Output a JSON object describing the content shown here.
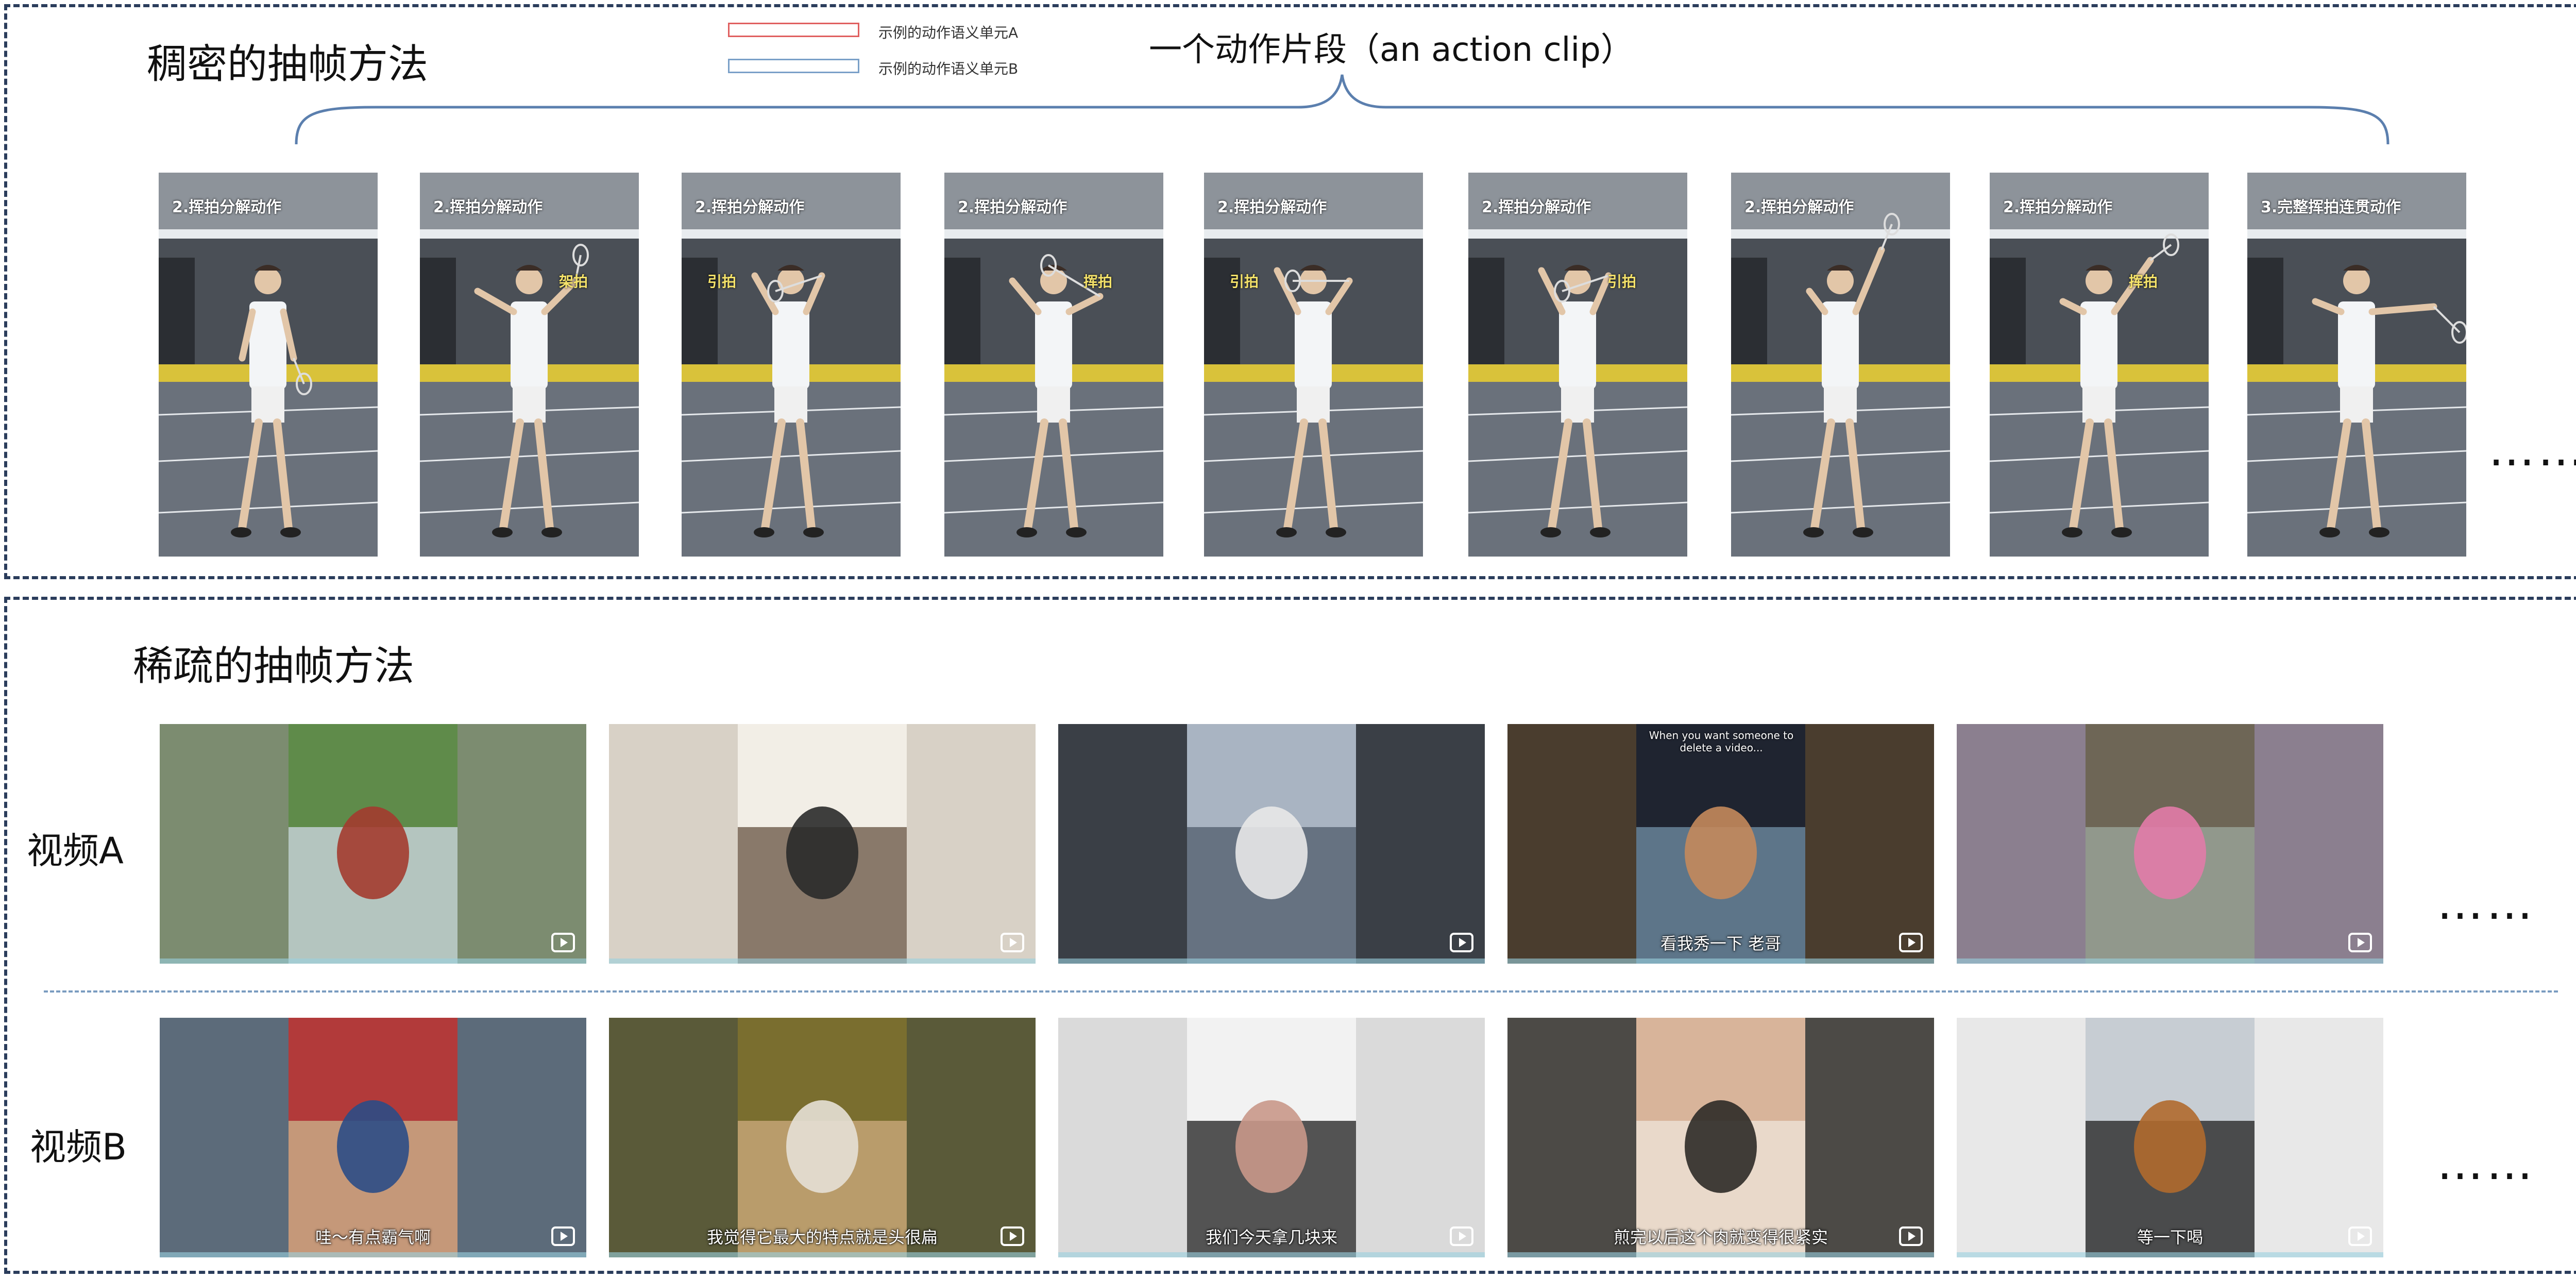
{
  "dense_section": {
    "title": "稠密的抽帧方法",
    "legend": [
      {
        "label": "示例的动作语义单元A",
        "color": "#e06060"
      },
      {
        "label": "示例的动作语义单元B",
        "color": "#7aa0c8"
      }
    ],
    "clip_label": "一个动作片段（an action clip）",
    "frame_tags": [
      "2.挥拍分解动作",
      "2.挥拍分解动作",
      "2.挥拍分解动作",
      "2.挥拍分解动作",
      "2.挥拍分解动作",
      "2.挥拍分解动作",
      "2.挥拍分解动作",
      "2.挥拍分解动作",
      "3.完整挥拍连贯动作"
    ],
    "frame_notes": [
      "",
      "架拍",
      "引拍",
      "挥拍",
      "引拍",
      "引拍",
      "",
      "挥拍",
      ""
    ],
    "ellipsis": "……"
  },
  "sparse_section": {
    "title": "稀疏的抽帧方法",
    "video_a": {
      "label": "视频A",
      "captions": [
        "",
        "",
        "",
        "看我秀一下 老哥",
        ""
      ],
      "top_text": [
        "",
        "",
        "",
        "When you want someone to delete a video...",
        ""
      ],
      "ellipsis": "……"
    },
    "video_b": {
      "label": "视频B",
      "captions": [
        "哇～有点霸气啊",
        "我觉得它最大的特点就是头很扁",
        "我们今天拿几块来",
        "煎完以后这个肉就变得很紧实",
        "等一下喝"
      ],
      "ellipsis": "……"
    }
  },
  "colors": {
    "border": "#2b3d5c",
    "brace": "#5b7fae",
    "divider": "#7a9cc0"
  }
}
